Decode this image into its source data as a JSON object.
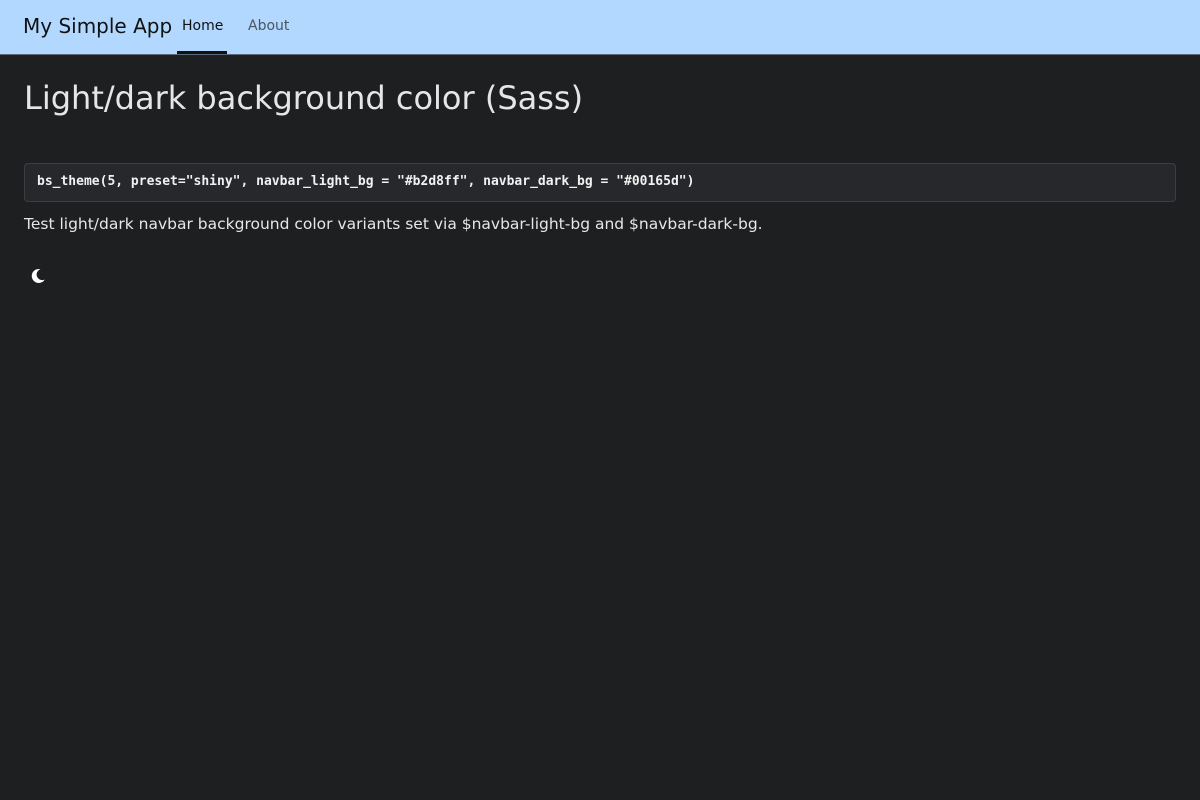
{
  "navbar": {
    "brand": "My Simple App",
    "tabs": [
      {
        "label": "Home",
        "active": true
      },
      {
        "label": "About",
        "active": false
      }
    ],
    "background_color": "#b2d8ff"
  },
  "main": {
    "title": "Light/dark background color (Sass)",
    "code": "bs_theme(5, preset=\"shiny\", navbar_light_bg = \"#b2d8ff\", navbar_dark_bg = \"#00165d\")",
    "description": "Test light/dark navbar background color variants set via $navbar-light-bg and $navbar-dark-bg.",
    "mode_toggle_icon": "moon-icon"
  },
  "colors": {
    "page_background": "#1e1f21",
    "text": "#e6e6e6"
  }
}
